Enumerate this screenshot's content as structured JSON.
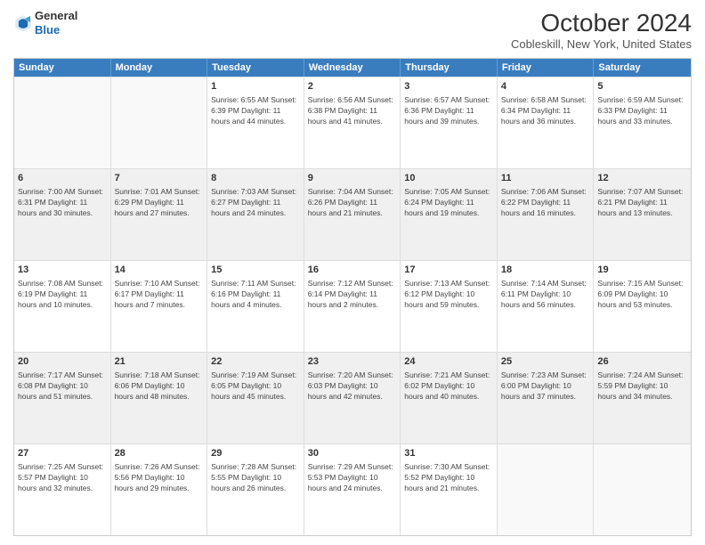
{
  "header": {
    "logo_line1": "General",
    "logo_line2": "Blue",
    "month_title": "October 2024",
    "subtitle": "Cobleskill, New York, United States"
  },
  "days_of_week": [
    "Sunday",
    "Monday",
    "Tuesday",
    "Wednesday",
    "Thursday",
    "Friday",
    "Saturday"
  ],
  "weeks": [
    [
      {
        "day": "",
        "detail": ""
      },
      {
        "day": "",
        "detail": ""
      },
      {
        "day": "1",
        "detail": "Sunrise: 6:55 AM\nSunset: 6:39 PM\nDaylight: 11 hours and 44 minutes."
      },
      {
        "day": "2",
        "detail": "Sunrise: 6:56 AM\nSunset: 6:38 PM\nDaylight: 11 hours and 41 minutes."
      },
      {
        "day": "3",
        "detail": "Sunrise: 6:57 AM\nSunset: 6:36 PM\nDaylight: 11 hours and 39 minutes."
      },
      {
        "day": "4",
        "detail": "Sunrise: 6:58 AM\nSunset: 6:34 PM\nDaylight: 11 hours and 36 minutes."
      },
      {
        "day": "5",
        "detail": "Sunrise: 6:59 AM\nSunset: 6:33 PM\nDaylight: 11 hours and 33 minutes."
      }
    ],
    [
      {
        "day": "6",
        "detail": "Sunrise: 7:00 AM\nSunset: 6:31 PM\nDaylight: 11 hours and 30 minutes."
      },
      {
        "day": "7",
        "detail": "Sunrise: 7:01 AM\nSunset: 6:29 PM\nDaylight: 11 hours and 27 minutes."
      },
      {
        "day": "8",
        "detail": "Sunrise: 7:03 AM\nSunset: 6:27 PM\nDaylight: 11 hours and 24 minutes."
      },
      {
        "day": "9",
        "detail": "Sunrise: 7:04 AM\nSunset: 6:26 PM\nDaylight: 11 hours and 21 minutes."
      },
      {
        "day": "10",
        "detail": "Sunrise: 7:05 AM\nSunset: 6:24 PM\nDaylight: 11 hours and 19 minutes."
      },
      {
        "day": "11",
        "detail": "Sunrise: 7:06 AM\nSunset: 6:22 PM\nDaylight: 11 hours and 16 minutes."
      },
      {
        "day": "12",
        "detail": "Sunrise: 7:07 AM\nSunset: 6:21 PM\nDaylight: 11 hours and 13 minutes."
      }
    ],
    [
      {
        "day": "13",
        "detail": "Sunrise: 7:08 AM\nSunset: 6:19 PM\nDaylight: 11 hours and 10 minutes."
      },
      {
        "day": "14",
        "detail": "Sunrise: 7:10 AM\nSunset: 6:17 PM\nDaylight: 11 hours and 7 minutes."
      },
      {
        "day": "15",
        "detail": "Sunrise: 7:11 AM\nSunset: 6:16 PM\nDaylight: 11 hours and 4 minutes."
      },
      {
        "day": "16",
        "detail": "Sunrise: 7:12 AM\nSunset: 6:14 PM\nDaylight: 11 hours and 2 minutes."
      },
      {
        "day": "17",
        "detail": "Sunrise: 7:13 AM\nSunset: 6:12 PM\nDaylight: 10 hours and 59 minutes."
      },
      {
        "day": "18",
        "detail": "Sunrise: 7:14 AM\nSunset: 6:11 PM\nDaylight: 10 hours and 56 minutes."
      },
      {
        "day": "19",
        "detail": "Sunrise: 7:15 AM\nSunset: 6:09 PM\nDaylight: 10 hours and 53 minutes."
      }
    ],
    [
      {
        "day": "20",
        "detail": "Sunrise: 7:17 AM\nSunset: 6:08 PM\nDaylight: 10 hours and 51 minutes."
      },
      {
        "day": "21",
        "detail": "Sunrise: 7:18 AM\nSunset: 6:06 PM\nDaylight: 10 hours and 48 minutes."
      },
      {
        "day": "22",
        "detail": "Sunrise: 7:19 AM\nSunset: 6:05 PM\nDaylight: 10 hours and 45 minutes."
      },
      {
        "day": "23",
        "detail": "Sunrise: 7:20 AM\nSunset: 6:03 PM\nDaylight: 10 hours and 42 minutes."
      },
      {
        "day": "24",
        "detail": "Sunrise: 7:21 AM\nSunset: 6:02 PM\nDaylight: 10 hours and 40 minutes."
      },
      {
        "day": "25",
        "detail": "Sunrise: 7:23 AM\nSunset: 6:00 PM\nDaylight: 10 hours and 37 minutes."
      },
      {
        "day": "26",
        "detail": "Sunrise: 7:24 AM\nSunset: 5:59 PM\nDaylight: 10 hours and 34 minutes."
      }
    ],
    [
      {
        "day": "27",
        "detail": "Sunrise: 7:25 AM\nSunset: 5:57 PM\nDaylight: 10 hours and 32 minutes."
      },
      {
        "day": "28",
        "detail": "Sunrise: 7:26 AM\nSunset: 5:56 PM\nDaylight: 10 hours and 29 minutes."
      },
      {
        "day": "29",
        "detail": "Sunrise: 7:28 AM\nSunset: 5:55 PM\nDaylight: 10 hours and 26 minutes."
      },
      {
        "day": "30",
        "detail": "Sunrise: 7:29 AM\nSunset: 5:53 PM\nDaylight: 10 hours and 24 minutes."
      },
      {
        "day": "31",
        "detail": "Sunrise: 7:30 AM\nSunset: 5:52 PM\nDaylight: 10 hours and 21 minutes."
      },
      {
        "day": "",
        "detail": ""
      },
      {
        "day": "",
        "detail": ""
      }
    ]
  ]
}
